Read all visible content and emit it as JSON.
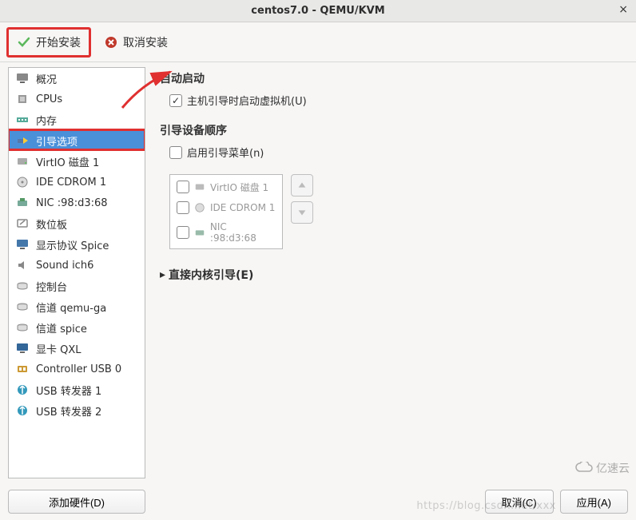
{
  "window": {
    "title": "centos7.0 - QEMU/KVM"
  },
  "toolbar": {
    "begin_install": "开始安装",
    "cancel_install": "取消安装"
  },
  "sidebar": {
    "items": [
      {
        "label": "概况",
        "icon": "monitor-icon"
      },
      {
        "label": "CPUs",
        "icon": "cpu-icon"
      },
      {
        "label": "内存",
        "icon": "memory-icon"
      },
      {
        "label": "引导选项",
        "icon": "boot-icon",
        "selected": true
      },
      {
        "label": "VirtIO 磁盘 1",
        "icon": "disk-icon"
      },
      {
        "label": "IDE CDROM 1",
        "icon": "cdrom-icon"
      },
      {
        "label": "NIC :98:d3:68",
        "icon": "nic-icon"
      },
      {
        "label": "数位板",
        "icon": "tablet-icon"
      },
      {
        "label": "显示协议 Spice",
        "icon": "display-icon"
      },
      {
        "label": "Sound ich6",
        "icon": "sound-icon"
      },
      {
        "label": "控制台",
        "icon": "console-icon"
      },
      {
        "label": "信道 qemu-ga",
        "icon": "channel-icon"
      },
      {
        "label": "信道 spice",
        "icon": "channel-icon"
      },
      {
        "label": "显卡 QXL",
        "icon": "video-icon"
      },
      {
        "label": "Controller USB 0",
        "icon": "usb-controller-icon"
      },
      {
        "label": "USB 转发器 1",
        "icon": "usb-redir-icon"
      },
      {
        "label": "USB 转发器 2",
        "icon": "usb-redir-icon"
      }
    ]
  },
  "main": {
    "autostart_title": "自动启动",
    "autostart_checkbox_label": "主机引导时启动虚拟机(U)",
    "autostart_checked": true,
    "boot_order_title": "引导设备顺序",
    "enable_boot_menu_label": "启用引导菜单(n)",
    "boot_devices": [
      {
        "label": "VirtIO 磁盘 1",
        "icon": "disk-icon"
      },
      {
        "label": "IDE CDROM 1",
        "icon": "cdrom-icon"
      },
      {
        "label": "NIC :98:d3:68",
        "icon": "nic-icon"
      }
    ],
    "direct_kernel_boot": "直接内核引导(E)"
  },
  "footer": {
    "add_hardware": "添加硬件(D)",
    "cancel": "取消(C)",
    "apply": "应用(A)"
  },
  "watermark": {
    "url": "https://blog.csdn.net/xxx",
    "logo_text": "亿速云"
  }
}
